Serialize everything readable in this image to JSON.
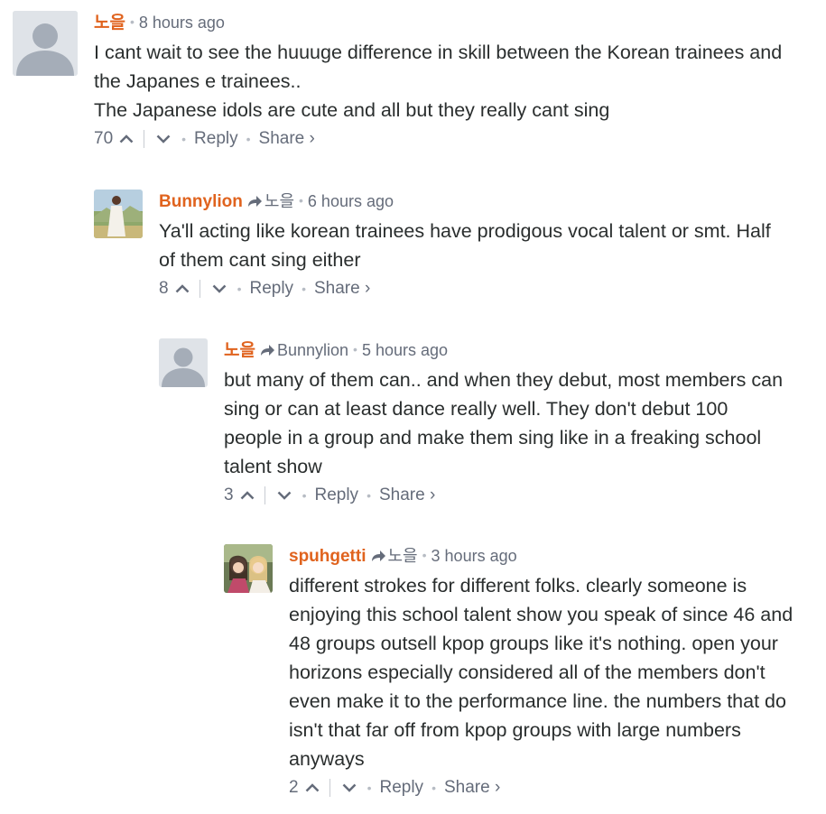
{
  "comments": [
    {
      "author": "노을",
      "parent": "",
      "time": "8 hours ago",
      "lines": [
        "I cant wait to see the huuuge difference in skill between the Korean trainees and",
        "the Japanes e trainees..",
        "The Japanese idols are cute and all but they really cant sing"
      ],
      "votes": "70",
      "reply_label": "Reply",
      "share_label": "Share ›",
      "avatar": "default-avatar-icon"
    },
    {
      "author": "Bunnylion",
      "parent": "노을",
      "time": "6 hours ago",
      "lines": [
        "Ya'll acting like korean trainees have prodigous vocal talent or smt. Half",
        "of them cant sing either"
      ],
      "votes": "8",
      "reply_label": "Reply",
      "share_label": "Share ›",
      "avatar": "photo-avatar"
    },
    {
      "author": "노을",
      "parent": "Bunnylion",
      "time": "5 hours ago",
      "lines": [
        "but many of them can.. and when they debut, most members can",
        "sing or can at least dance really well. They don't debut 100",
        "people in a group and make them sing like in a freaking school",
        "talent show"
      ],
      "votes": "3",
      "reply_label": "Reply",
      "share_label": "Share ›",
      "avatar": "default-avatar-icon"
    },
    {
      "author": "spuhgetti",
      "parent": "노을",
      "time": "3 hours ago",
      "lines": [
        "different strokes for different folks. clearly someone is",
        "enjoying this school talent show you speak of since 46 and",
        "48 groups outsell kpop groups like it's nothing. open your",
        "horizons especially considered all of the members don't",
        "even make it to the performance line. the numbers that do",
        "isn't that far off from kpop groups with large numbers",
        "anyways"
      ],
      "votes": "2",
      "reply_label": "Reply",
      "share_label": "Share ›",
      "avatar": "photo-avatar"
    }
  ],
  "colors": {
    "author": "#e0631e",
    "meta": "#656c7a",
    "text": "#2a2e2e",
    "avatar_bg": "#dfe3e8",
    "avatar_fg": "#a5adb8"
  }
}
